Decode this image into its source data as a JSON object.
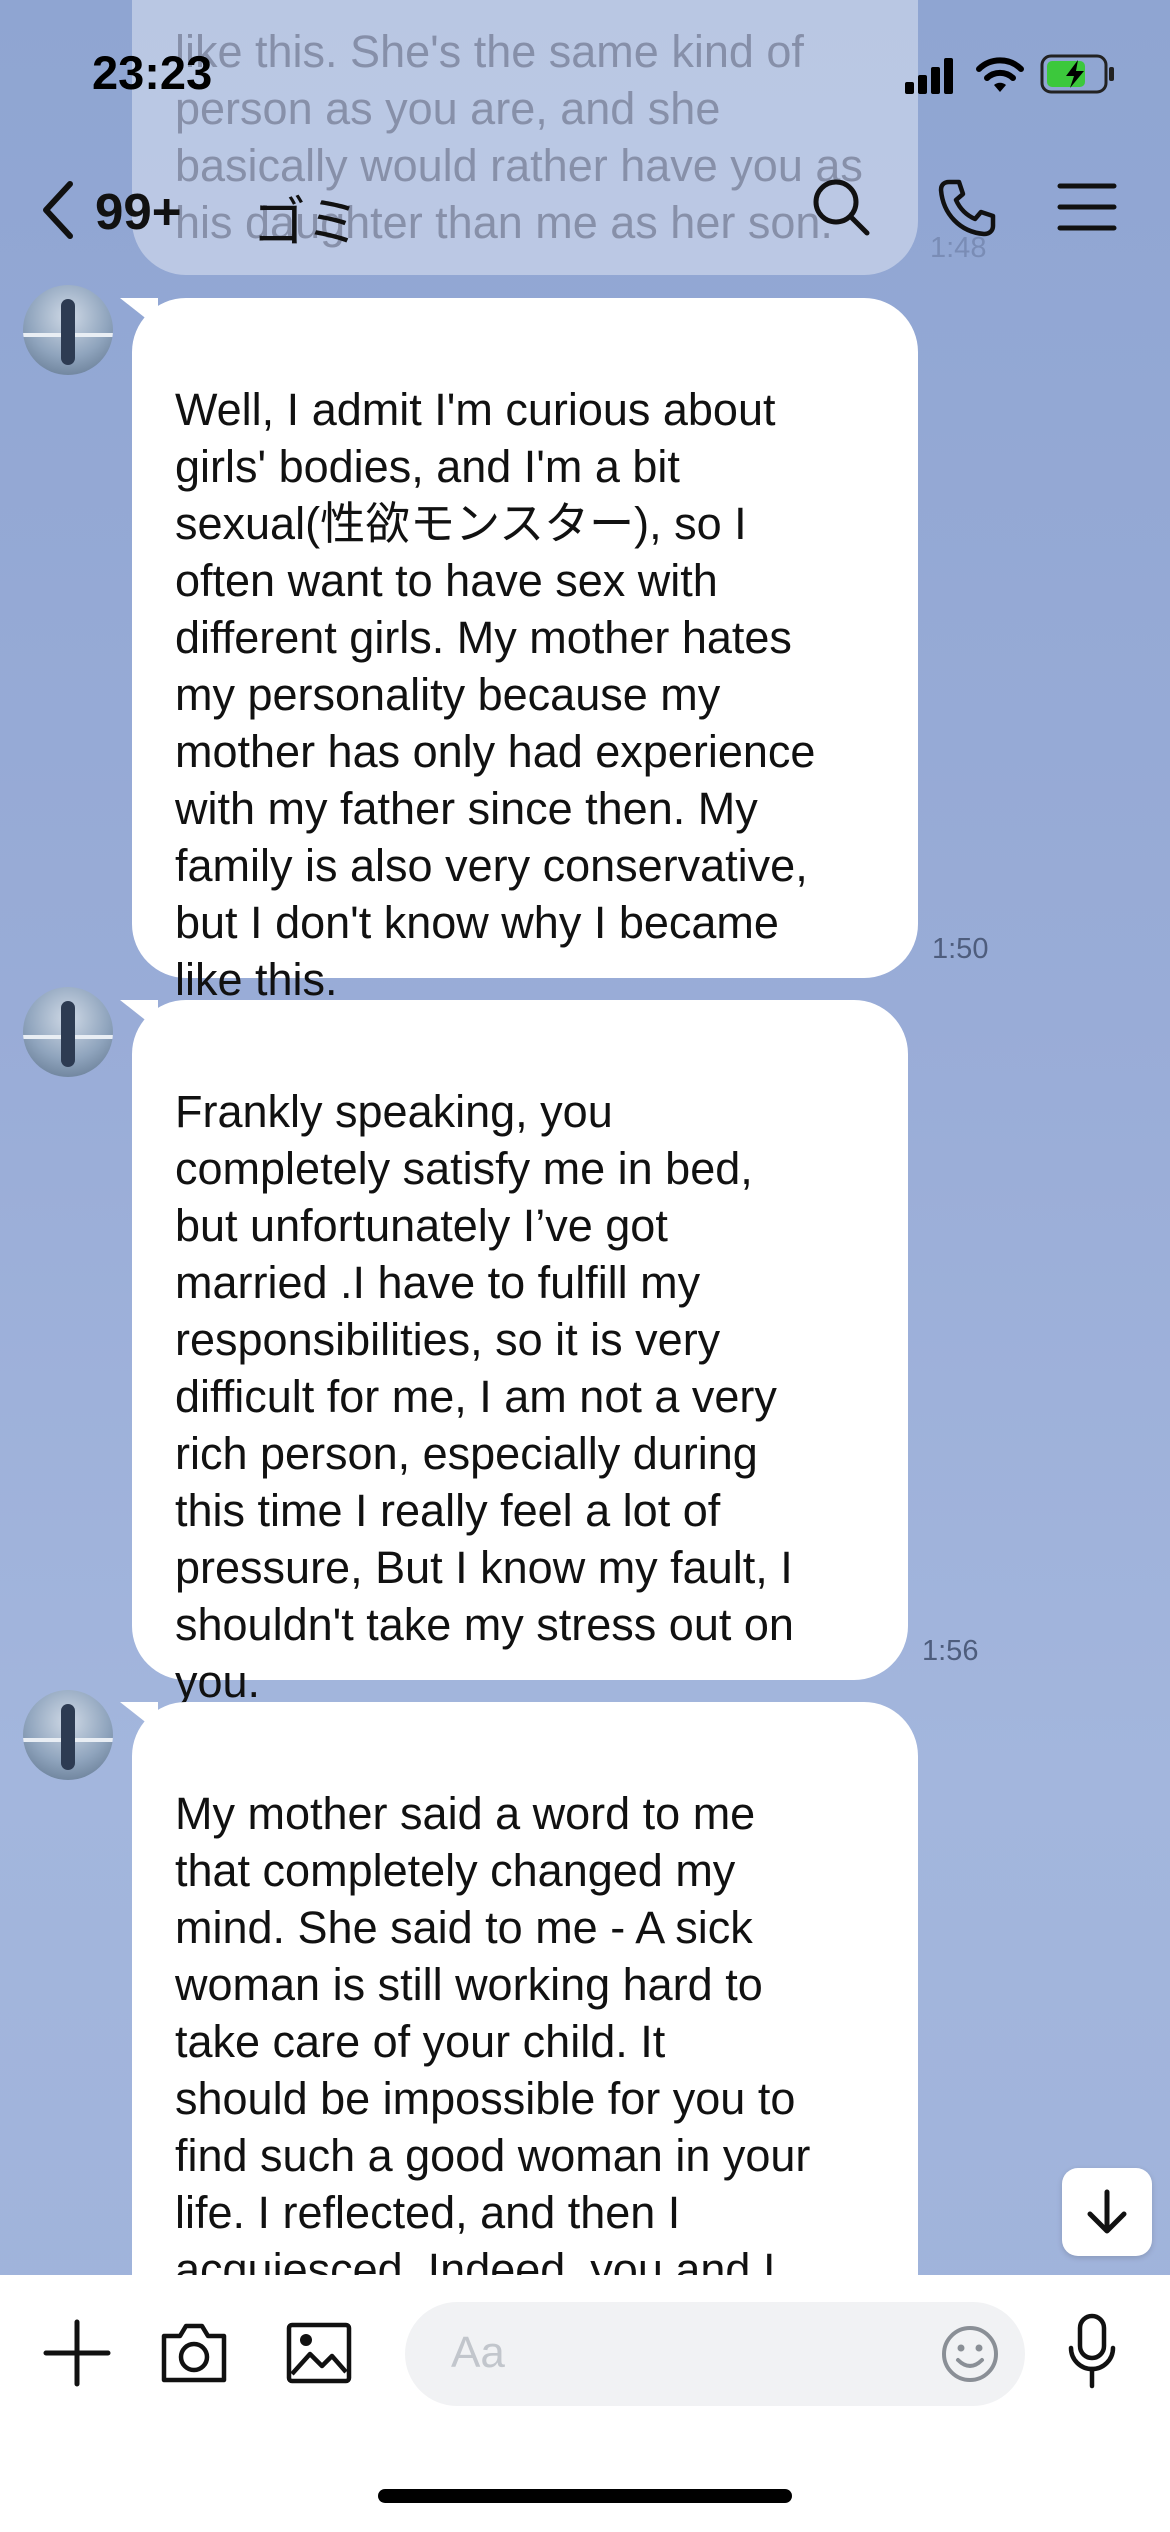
{
  "status": {
    "time": "23:23"
  },
  "header": {
    "back_count": "99+",
    "title": "ゴミ"
  },
  "messages": [
    {
      "text": "like this.  She's the same kind of person as you are, and she basically would rather have you as his daughter than me as her son.",
      "time": "1:48"
    },
    {
      "text": "Well, I admit I'm curious about\ngirls' bodies, and I'm a bit\nsexual(性欲モンスター), so I\noften want to have sex with\ndifferent girls.  My mother hates\nmy personality because my\nmother has only had experience\nwith my father since then.  My\nfamily is also very conservative,\nbut I don't know why I became\nlike this.",
      "time": "1:50"
    },
    {
      "text": "Frankly speaking, you\ncompletely satisfy me in bed,\nbut unfortunately I’ve got\nmarried .I  have to fulfill my\nresponsibilities, so it is very\ndifficult for me, I am not a very\nrich person, especially during\nthis time I really feel a lot of\npressure,  But I know my fault, I\nshouldn't take my stress out on\nyou.",
      "time": "1:56"
    },
    {
      "text": "My mother said a word to me\nthat completely changed my\nmind.  She said to me - A sick\nwoman is still working hard to\ntake care of your  child. It\nshould be impossible for you to\nfind such a good woman in your\nlife.  I reflected, and then I\nacquiesced.  Indeed, you and I\nare both artists, you and I are",
      "time": ""
    }
  ],
  "composer": {
    "placeholder": "Aa"
  }
}
